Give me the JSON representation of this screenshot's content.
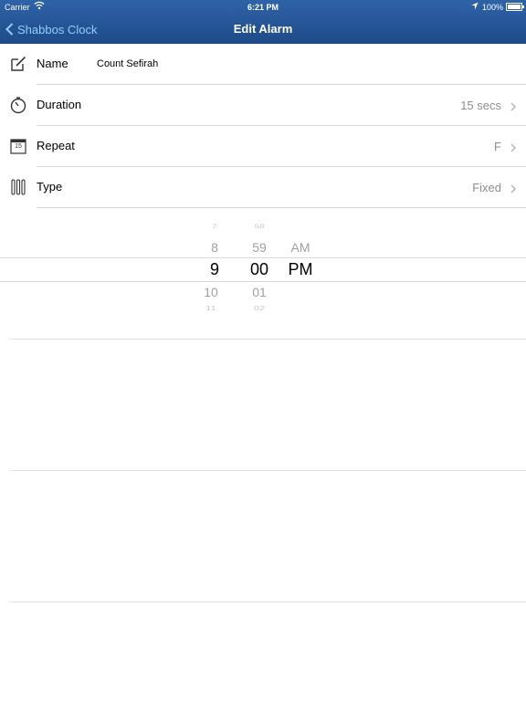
{
  "status_bar": {
    "carrier": "Carrier",
    "time": "6:21 PM",
    "battery": "100%"
  },
  "nav": {
    "back_label": "Shabbos Clock",
    "title": "Edit Alarm"
  },
  "rows": [
    {
      "label": "Name",
      "value": "Count Sefirah",
      "icon": "edit-icon"
    },
    {
      "label": "Duration",
      "value": "15 secs",
      "icon": "timer-icon"
    },
    {
      "label": "Repeat",
      "value": "F",
      "icon": "calendar-icon",
      "calendar_number": "15"
    },
    {
      "label": "Type",
      "value": "Fixed",
      "icon": "type-bars-icon"
    }
  ],
  "picker": {
    "hours": {
      "faint_above": "7",
      "above": "8",
      "selected": "9",
      "below": "10",
      "faint_below": "11"
    },
    "minutes": {
      "faint_above": "58",
      "above": "59",
      "selected": "00",
      "below": "01",
      "faint_below": "02"
    },
    "ampm": {
      "above": "AM",
      "selected": "PM"
    }
  },
  "colors": {
    "nav_bar": "#2a5a9c",
    "back_text": "#8fd0f5",
    "secondary_text": "#8e8e93"
  }
}
